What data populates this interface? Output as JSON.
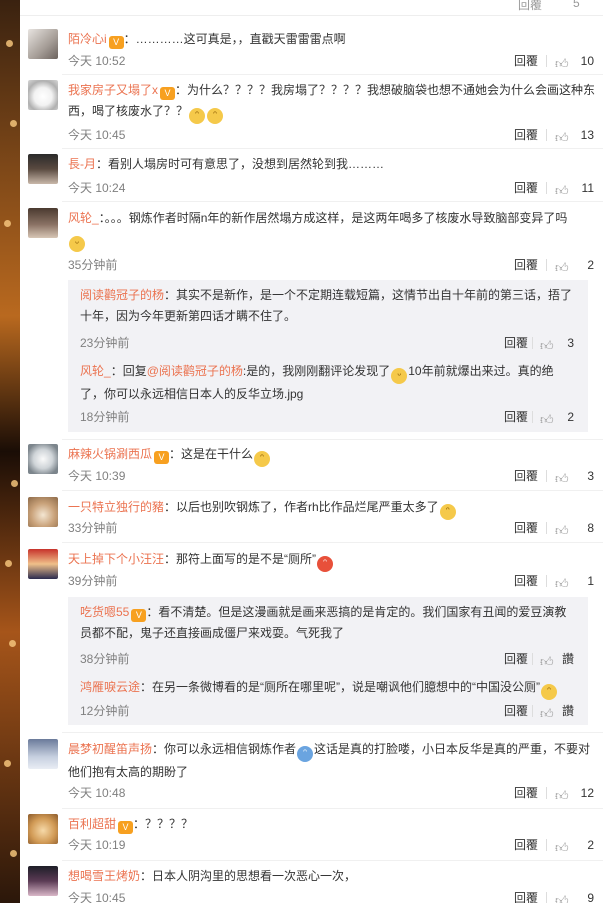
{
  "top_partial": {
    "reply_label": "回覆",
    "like_count": "5"
  },
  "labels": {
    "reply": "回覆"
  },
  "comments": [
    {
      "user": "陌冷心i",
      "text": "：…………这可真是，，直戳天雷雷雷点啊",
      "time": "今天 10:52",
      "likes": "10"
    },
    {
      "user": "我家房子又塌了x",
      "text_a": "：为什么？？？？我房塌了？？？？我想破脑袋也想不通她会为什么会画这种东西，喝了核废水了？？",
      "time": "今天 10:45",
      "likes": "13"
    },
    {
      "user": "長-月",
      "text": "：看别人塌房时可有意思了，没想到居然轮到我………",
      "time": "今天 10:24",
      "likes": "11"
    },
    {
      "user": "风轮_",
      "text": "：。。。钢炼作者时隔n年的新作居然塌方成这样，是这两年喝多了核废水导致脑部变异了吗",
      "time": "35分钟前",
      "likes": "2",
      "replies": [
        {
          "user": "阅读鹳冠子的杨",
          "text": "：其实不是新作，是一个不定期连载短篇，这情节出自十年前的第三话，捂了十年，因为今年更新第四话才瞒不住了。",
          "time": "23分钟前",
          "likes": "3"
        },
        {
          "user": "风轮_",
          "text_a": "：回复",
          "mention": "@阅读鹳冠子的杨",
          "text_b": ":是的，我刚刚翻评论发现了",
          "text_c": "10年前就爆出来过。真的绝了，你可以永远相信日本人的反华立场.jpg",
          "time": "18分钟前",
          "likes": "2"
        }
      ]
    },
    {
      "user": "麻辣火锅涮西瓜",
      "text": "：这是在干什么",
      "time": "今天 10:39",
      "likes": "3"
    },
    {
      "user": "一只特立独行的豬",
      "text": "：以后也别吹钢炼了，作者rh比作品烂尾严重太多了",
      "time": "33分钟前",
      "likes": "8"
    },
    {
      "user": "天上掉下个小汪汪",
      "text": "：那符上面写的是不是“厕所”",
      "time": "39分钟前",
      "likes": "1",
      "replies": [
        {
          "user": "吃货嗯55",
          "text": "：看不清楚。但是这漫画就是画来恶搞的是肯定的。我们国家有丑闻的爱豆演教员都不配，鬼子还直接画成僵尸来戏耍。气死我了",
          "time": "38分钟前",
          "likes": "讚"
        },
        {
          "user": "鸿雁唳云途",
          "text": "：在另一条微博看的是“厕所在哪里呢”，说是嘲讽他们臆想中的“中国没公厕”",
          "time": "12分钟前",
          "likes": "讚"
        }
      ]
    },
    {
      "user": "晨梦初醒笛声扬",
      "text_a": "：你可以永远相信钢炼作者",
      "text_b": "这话是真的打脸喽，小日本反华是真的严重，不要对他们抱有太高的期盼了",
      "time": "今天 10:48",
      "likes": "12"
    },
    {
      "user": "百利超甜",
      "text": "：？？？？",
      "time": "今天 10:19",
      "likes": "2"
    },
    {
      "user": "想喝雪王烤奶",
      "text": "：日本人阴沟里的思想看一次恶心一次，",
      "time": "今天 10:45",
      "likes": "9"
    }
  ],
  "colors": {
    "username": "#eb7350",
    "sub_bg": "#f2f2f5",
    "meta": "#808080"
  }
}
